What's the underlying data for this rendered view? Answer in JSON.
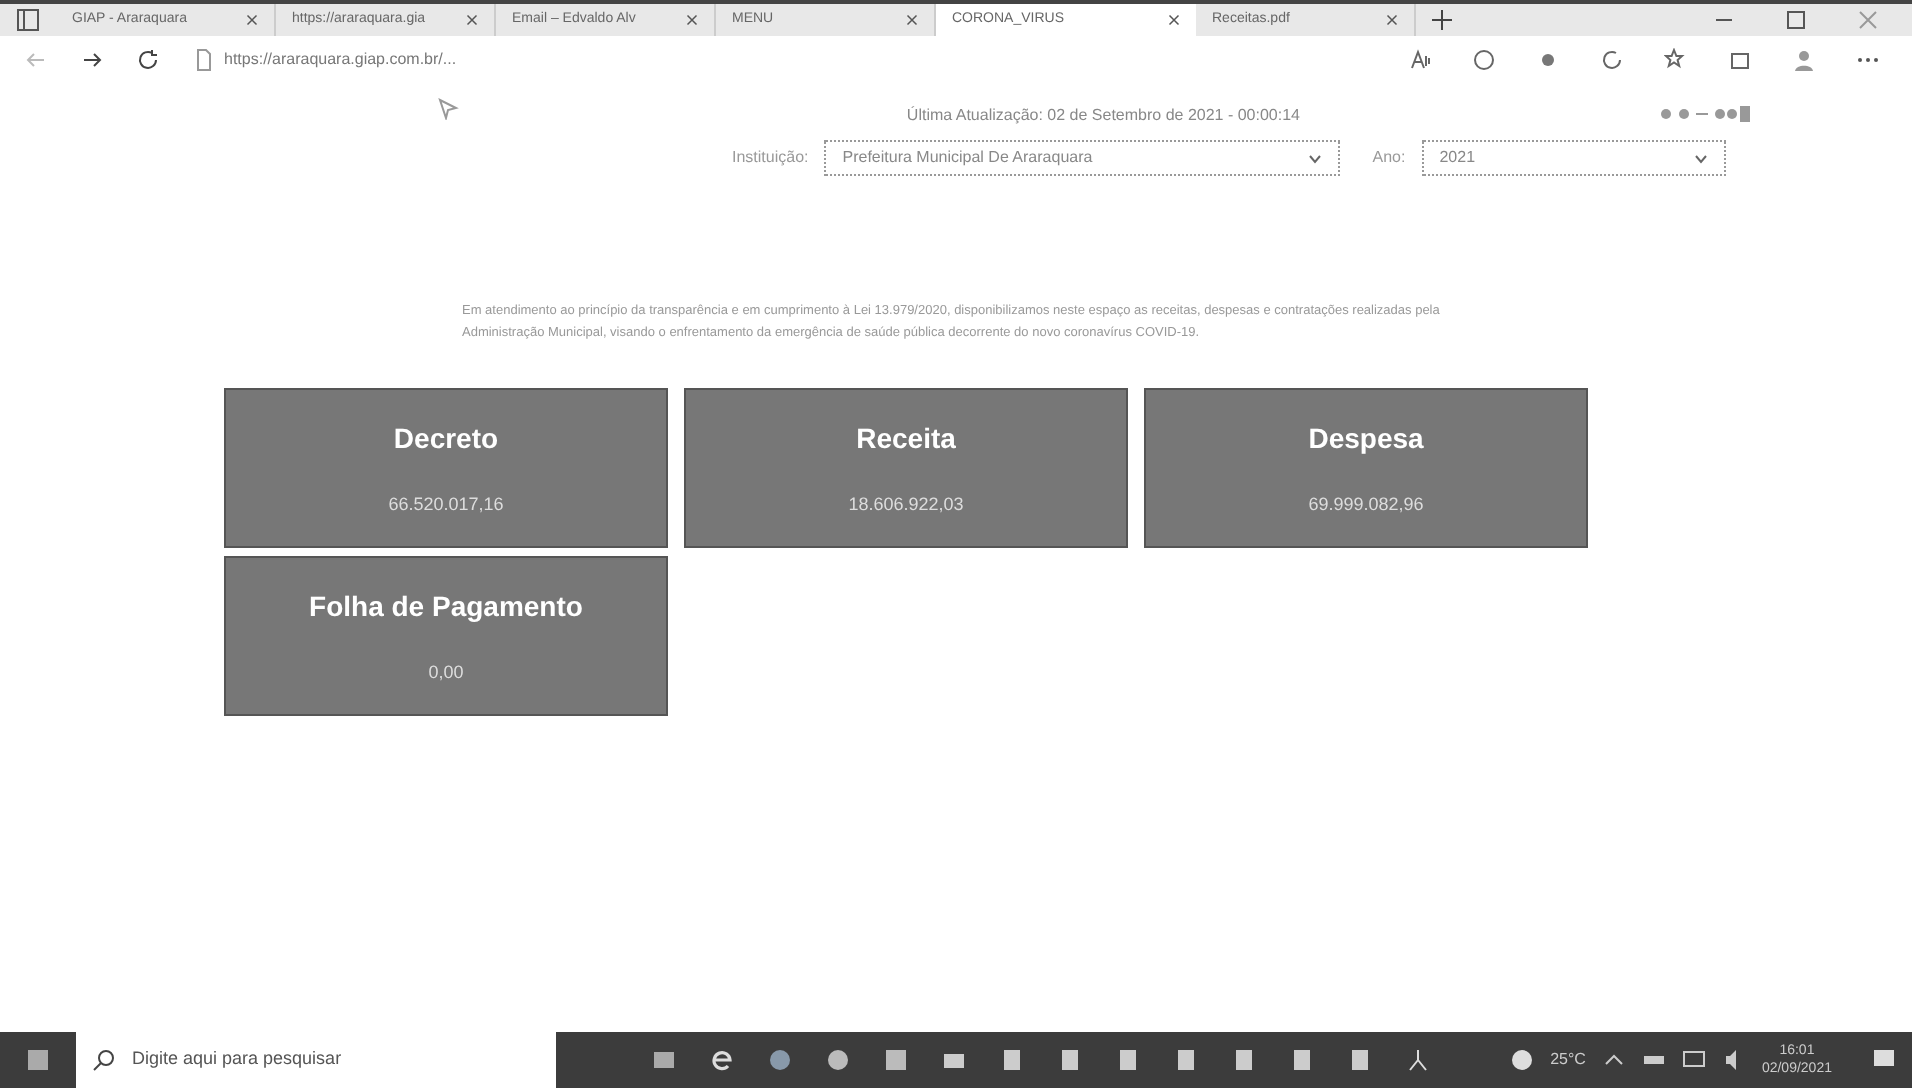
{
  "browser": {
    "tabs": [
      {
        "title": "GIAP - Araraquara",
        "selected": false
      },
      {
        "title": "https://araraquara.gia",
        "selected": false
      },
      {
        "title": "Email – Edvaldo Alv",
        "selected": false
      },
      {
        "title": "MENU",
        "selected": false
      },
      {
        "title": "CORONA_VIRUS",
        "selected": true
      },
      {
        "title": "Receitas.pdf",
        "selected": false
      }
    ],
    "address": "https://araraquara.giap.com.br/..."
  },
  "page": {
    "updated": "Última Atualização: 02 de Setembro de 2021 - 00:00:14",
    "institution_label": "Instituição:",
    "institution": "Prefeitura Municipal De Araraquara",
    "year_label": "Ano:",
    "year": "2021",
    "intro": "Em atendimento ao princípio da transparência e em cumprimento à Lei 13.979/2020, disponibilizamos neste espaço as receitas, despesas e contratações realizadas pela Administração Municipal, visando o enfrentamento da emergência de saúde pública decorrente do novo coronavírus COVID-19.",
    "cards": [
      {
        "title": "Decreto",
        "value": "66.520.017,16"
      },
      {
        "title": "Receita",
        "value": "18.606.922,03"
      },
      {
        "title": "Despesa",
        "value": "69.999.082,96"
      },
      {
        "title": "Folha de Pagamento",
        "value": "0,00"
      }
    ]
  },
  "taskbar": {
    "search_placeholder": "Digite aqui para pesquisar",
    "temperature": "25°C",
    "time": "16:01",
    "date": "02/09/2021"
  }
}
